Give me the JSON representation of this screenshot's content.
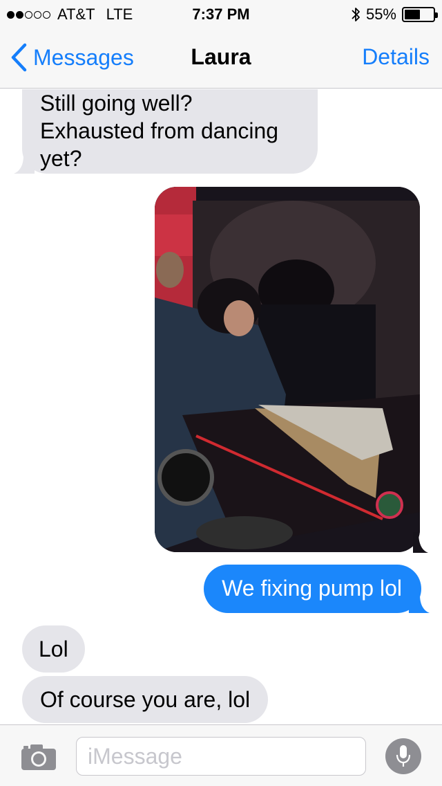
{
  "status_bar": {
    "signal_filled": 2,
    "signal_total": 5,
    "carrier": "AT&T",
    "network": "LTE",
    "time": "7:37 PM",
    "bluetooth_icon": "bluetooth-icon",
    "battery_percent": "55%",
    "battery_level": 0.55
  },
  "nav": {
    "back_label": "Messages",
    "title": "Laura",
    "details_label": "Details"
  },
  "messages": [
    {
      "direction": "incoming",
      "text": "Still going well? Exhausted from dancing yet?"
    },
    {
      "direction": "outgoing",
      "type": "photo",
      "icon": "photo-attachment-icon"
    },
    {
      "direction": "outgoing",
      "text": "We fixing pump lol"
    },
    {
      "direction": "incoming",
      "text": "Lol"
    },
    {
      "direction": "incoming",
      "text": "Of course you are, lol"
    }
  ],
  "input_bar": {
    "camera_icon": "camera-icon",
    "placeholder": "iMessage",
    "value": "",
    "mic_icon": "microphone-icon"
  },
  "colors": {
    "accent": "#157efb",
    "outgoing_bubble": "#1b87fb",
    "incoming_bubble": "#e5e5ea",
    "bar_background": "#f7f7f7"
  }
}
